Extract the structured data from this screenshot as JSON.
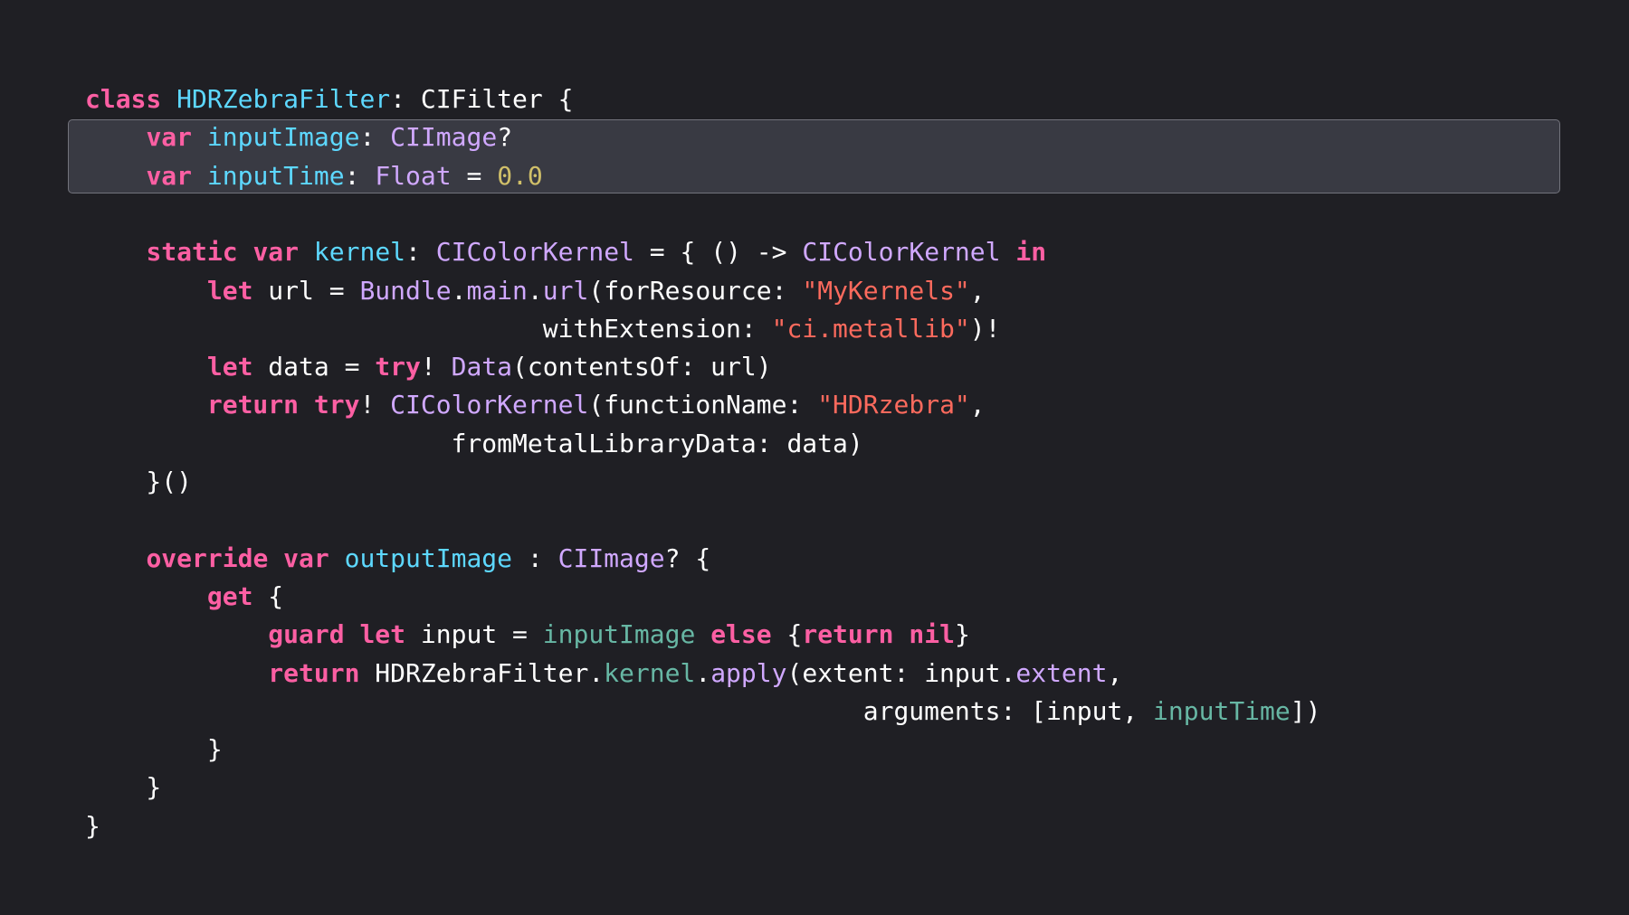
{
  "theme": {
    "background": "#1f1f24",
    "highlight_background": "#393a43",
    "highlight_border": "#72737c",
    "colors": {
      "keyword": "#fc5fa3",
      "decl": "#5dd8ff",
      "type": "#d0a8ff",
      "project": "#67b7a4",
      "string": "#fc6a5d",
      "number": "#d0bf69",
      "plain": "#ffffff"
    }
  },
  "highlighted_lines": [
    1,
    2
  ],
  "code": [
    [
      [
        "keyword",
        "class"
      ],
      [
        "plain",
        " "
      ],
      [
        "decl",
        "HDRZebraFilter"
      ],
      [
        "plain",
        ": CIFilter {"
      ]
    ],
    [
      [
        "plain",
        "    "
      ],
      [
        "keyword",
        "var"
      ],
      [
        "plain",
        " "
      ],
      [
        "decl",
        "inputImage"
      ],
      [
        "plain",
        ": "
      ],
      [
        "type",
        "CIImage"
      ],
      [
        "plain",
        "?"
      ]
    ],
    [
      [
        "plain",
        "    "
      ],
      [
        "keyword",
        "var"
      ],
      [
        "plain",
        " "
      ],
      [
        "decl",
        "inputTime"
      ],
      [
        "plain",
        ": "
      ],
      [
        "type",
        "Float"
      ],
      [
        "plain",
        " = "
      ],
      [
        "number",
        "0.0"
      ]
    ],
    [],
    [
      [
        "plain",
        "    "
      ],
      [
        "keyword",
        "static"
      ],
      [
        "plain",
        " "
      ],
      [
        "keyword",
        "var"
      ],
      [
        "plain",
        " "
      ],
      [
        "decl",
        "kernel"
      ],
      [
        "plain",
        ": "
      ],
      [
        "type",
        "CIColorKernel"
      ],
      [
        "plain",
        " = { () -> "
      ],
      [
        "type",
        "CIColorKernel"
      ],
      [
        "plain",
        " "
      ],
      [
        "keyword",
        "in"
      ]
    ],
    [
      [
        "plain",
        "        "
      ],
      [
        "keyword",
        "let"
      ],
      [
        "plain",
        " url = "
      ],
      [
        "type",
        "Bundle"
      ],
      [
        "plain",
        "."
      ],
      [
        "type",
        "main"
      ],
      [
        "plain",
        "."
      ],
      [
        "type",
        "url"
      ],
      [
        "plain",
        "(forResource: "
      ],
      [
        "string",
        "\"MyKernels\""
      ],
      [
        "plain",
        ","
      ]
    ],
    [
      [
        "plain",
        "                              withExtension: "
      ],
      [
        "string",
        "\"ci.metallib\""
      ],
      [
        "plain",
        ")!"
      ]
    ],
    [
      [
        "plain",
        "        "
      ],
      [
        "keyword",
        "let"
      ],
      [
        "plain",
        " data = "
      ],
      [
        "keyword",
        "try"
      ],
      [
        "plain",
        "! "
      ],
      [
        "type",
        "Data"
      ],
      [
        "plain",
        "(contentsOf: url)"
      ]
    ],
    [
      [
        "plain",
        "        "
      ],
      [
        "keyword",
        "return"
      ],
      [
        "plain",
        " "
      ],
      [
        "keyword",
        "try"
      ],
      [
        "plain",
        "! "
      ],
      [
        "type",
        "CIColorKernel"
      ],
      [
        "plain",
        "(functionName: "
      ],
      [
        "string",
        "\"HDRzebra\""
      ],
      [
        "plain",
        ","
      ]
    ],
    [
      [
        "plain",
        "                        fromMetalLibraryData: data)"
      ]
    ],
    [
      [
        "plain",
        "    }()"
      ]
    ],
    [],
    [
      [
        "plain",
        "    "
      ],
      [
        "keyword",
        "override"
      ],
      [
        "plain",
        " "
      ],
      [
        "keyword",
        "var"
      ],
      [
        "plain",
        " "
      ],
      [
        "decl",
        "outputImage"
      ],
      [
        "plain",
        " : "
      ],
      [
        "type",
        "CIImage"
      ],
      [
        "plain",
        "? {"
      ]
    ],
    [
      [
        "plain",
        "        "
      ],
      [
        "keyword",
        "get"
      ],
      [
        "plain",
        " {"
      ]
    ],
    [
      [
        "plain",
        "            "
      ],
      [
        "keyword",
        "guard"
      ],
      [
        "plain",
        " "
      ],
      [
        "keyword",
        "let"
      ],
      [
        "plain",
        " input = "
      ],
      [
        "project",
        "inputImage"
      ],
      [
        "plain",
        " "
      ],
      [
        "keyword",
        "else"
      ],
      [
        "plain",
        " {"
      ],
      [
        "keyword",
        "return"
      ],
      [
        "plain",
        " "
      ],
      [
        "keyword",
        "nil"
      ],
      [
        "plain",
        "}"
      ]
    ],
    [
      [
        "plain",
        "            "
      ],
      [
        "keyword",
        "return"
      ],
      [
        "plain",
        " HDRZebraFilter."
      ],
      [
        "project",
        "kernel"
      ],
      [
        "plain",
        "."
      ],
      [
        "type",
        "apply"
      ],
      [
        "plain",
        "(extent: input."
      ],
      [
        "type",
        "extent"
      ],
      [
        "plain",
        ","
      ]
    ],
    [
      [
        "plain",
        "                                                   arguments: [input, "
      ],
      [
        "project",
        "inputTime"
      ],
      [
        "plain",
        "])"
      ]
    ],
    [
      [
        "plain",
        "        }"
      ]
    ],
    [
      [
        "plain",
        "    }"
      ]
    ],
    [
      [
        "plain",
        "}"
      ]
    ]
  ]
}
